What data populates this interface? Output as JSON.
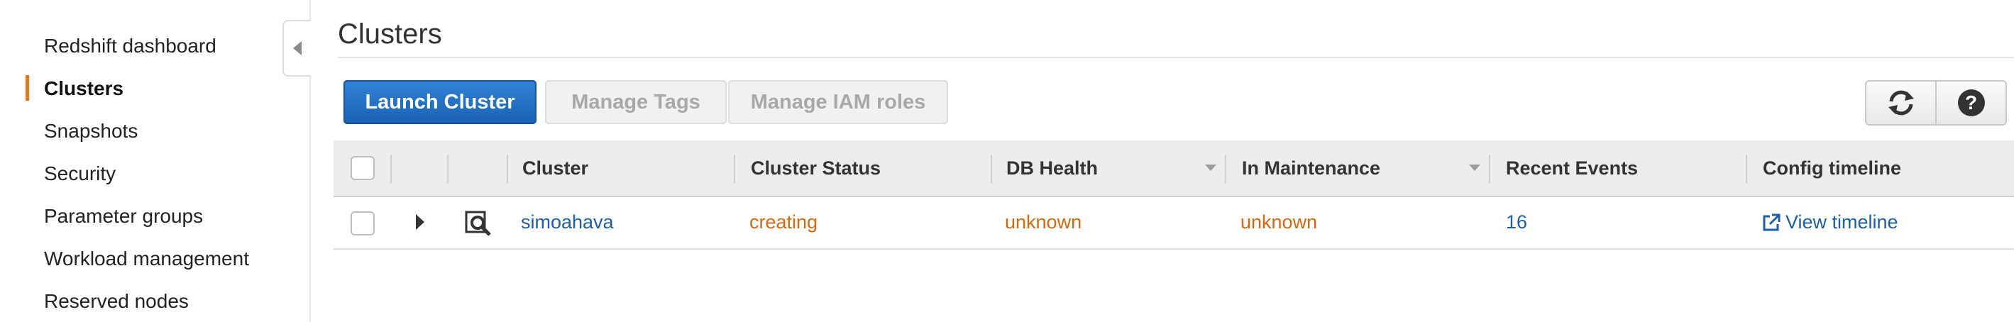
{
  "sidebar": {
    "items": [
      {
        "label": "Redshift dashboard",
        "active": false
      },
      {
        "label": "Clusters",
        "active": true
      },
      {
        "label": "Snapshots",
        "active": false
      },
      {
        "label": "Security",
        "active": false
      },
      {
        "label": "Parameter groups",
        "active": false
      },
      {
        "label": "Workload management",
        "active": false
      },
      {
        "label": "Reserved nodes",
        "active": false
      }
    ],
    "collapse_icon": "chevron-left-icon",
    "active_color": "#e07b1a"
  },
  "page": {
    "title": "Clusters"
  },
  "toolbar": {
    "launch_label": "Launch Cluster",
    "manage_tags_label": "Manage Tags",
    "manage_iam_label": "Manage IAM roles",
    "refresh_icon": "refresh-icon",
    "help_icon": "help-icon",
    "help_glyph": "?"
  },
  "table": {
    "columns": [
      "Cluster",
      "Cluster Status",
      "DB Health",
      "In Maintenance",
      "Recent Events",
      "Config timeline"
    ],
    "rows": [
      {
        "cluster": "simoahava",
        "status": "creating",
        "db_health": "unknown",
        "in_maintenance": "unknown",
        "recent_events": "16",
        "config_timeline": "View timeline"
      }
    ]
  },
  "colors": {
    "primary": "#1a62b4",
    "link": "#1a5fa8",
    "warning": "#d9670c"
  }
}
